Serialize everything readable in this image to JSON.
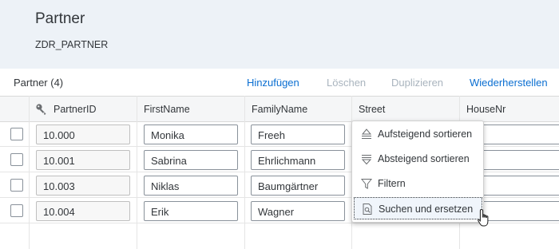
{
  "header": {
    "title": "Partner",
    "subtitle": "ZDR_PARTNER"
  },
  "toolbar": {
    "count": "Partner (4)",
    "add": "Hinzufügen",
    "delete": "Löschen",
    "duplicate": "Duplizieren",
    "restore": "Wiederherstellen"
  },
  "columns": {
    "partnerid": "PartnerID",
    "firstname": "FirstName",
    "familyname": "FamilyName",
    "street": "Street",
    "housenr": "HouseNr"
  },
  "rows": [
    {
      "partnerid": "10.000",
      "firstname": "Monika",
      "familyname": "Freeh"
    },
    {
      "partnerid": "10.001",
      "firstname": "Sabrina",
      "familyname": "Ehrlichmann"
    },
    {
      "partnerid": "10.003",
      "firstname": "Niklas",
      "familyname": "Baumgärtner"
    },
    {
      "partnerid": "10.004",
      "firstname": "Erik",
      "familyname": "Wagner"
    }
  ],
  "menu": {
    "sort_asc": "Aufsteigend sortieren",
    "sort_desc": "Absteigend sortieren",
    "filter": "Filtern",
    "find_replace": "Suchen und ersetzen"
  },
  "icons": {
    "key": "key-icon",
    "sort_asc": "sort-ascending-icon",
    "sort_desc": "sort-descending-icon",
    "filter": "filter-icon",
    "find_replace": "find-replace-icon",
    "cursor": "hand-pointer-icon"
  },
  "colors": {
    "link": "#0a6ed1",
    "disabled": "#a9b4be",
    "header_bg": "#edf2f7"
  }
}
